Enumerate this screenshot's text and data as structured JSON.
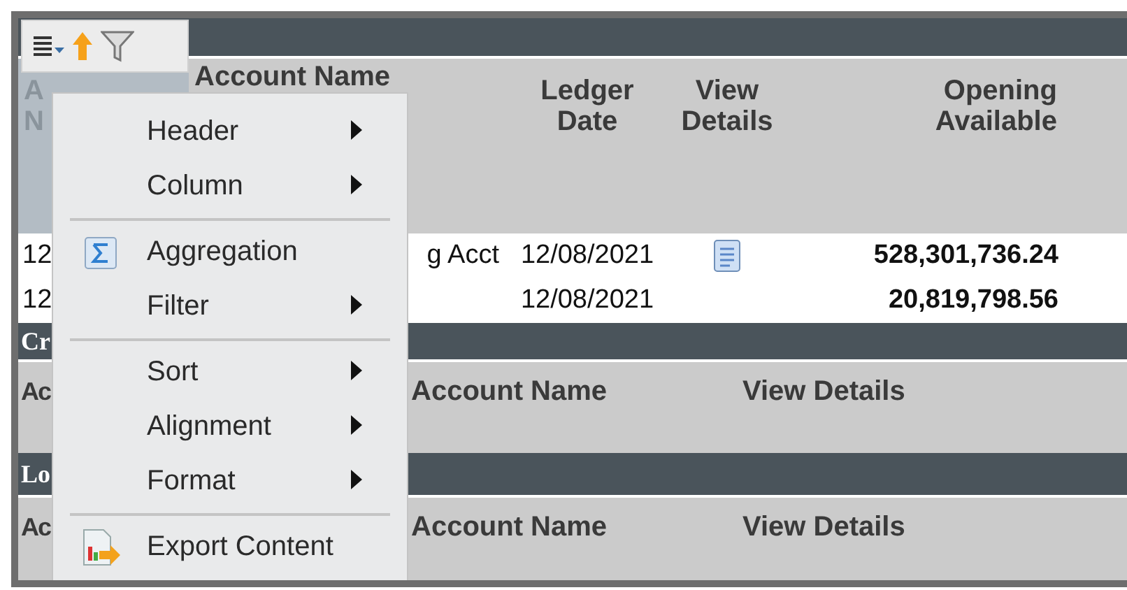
{
  "summary": {
    "columns": [
      {
        "label": "A N",
        "selected": true
      },
      {
        "label": "Account Name",
        "selected": false
      },
      {
        "label": "Ledger Date",
        "selected": false
      },
      {
        "label": "View Details",
        "selected": false
      },
      {
        "label": "Opening Available",
        "selected": false
      }
    ],
    "rows": [
      {
        "account": "12",
        "name": "g Acct",
        "date": "12/08/2021",
        "details": true,
        "amount": "528,301,736.24"
      },
      {
        "account": "12",
        "name": "",
        "date": "12/08/2021",
        "details": false,
        "amount": "20,819,798.56"
      }
    ]
  },
  "sections": [
    {
      "title": "Cr",
      "columns": [
        "Ac",
        "Account Name",
        "View Details"
      ]
    },
    {
      "title": "Lo",
      "columns": [
        "Ac",
        "Account Name",
        "View Details"
      ]
    }
  ],
  "menu": {
    "items": [
      {
        "kind": "submenu",
        "label": "Header"
      },
      {
        "kind": "submenu",
        "label": "Column"
      },
      {
        "kind": "separator"
      },
      {
        "kind": "aggregate",
        "label": "Aggregation"
      },
      {
        "kind": "submenu",
        "label": "Filter"
      },
      {
        "kind": "separator"
      },
      {
        "kind": "submenu",
        "label": "Sort"
      },
      {
        "kind": "submenu",
        "label": "Alignment"
      },
      {
        "kind": "submenu",
        "label": "Format"
      },
      {
        "kind": "separator"
      },
      {
        "kind": "export",
        "label": "Export Content"
      }
    ]
  }
}
